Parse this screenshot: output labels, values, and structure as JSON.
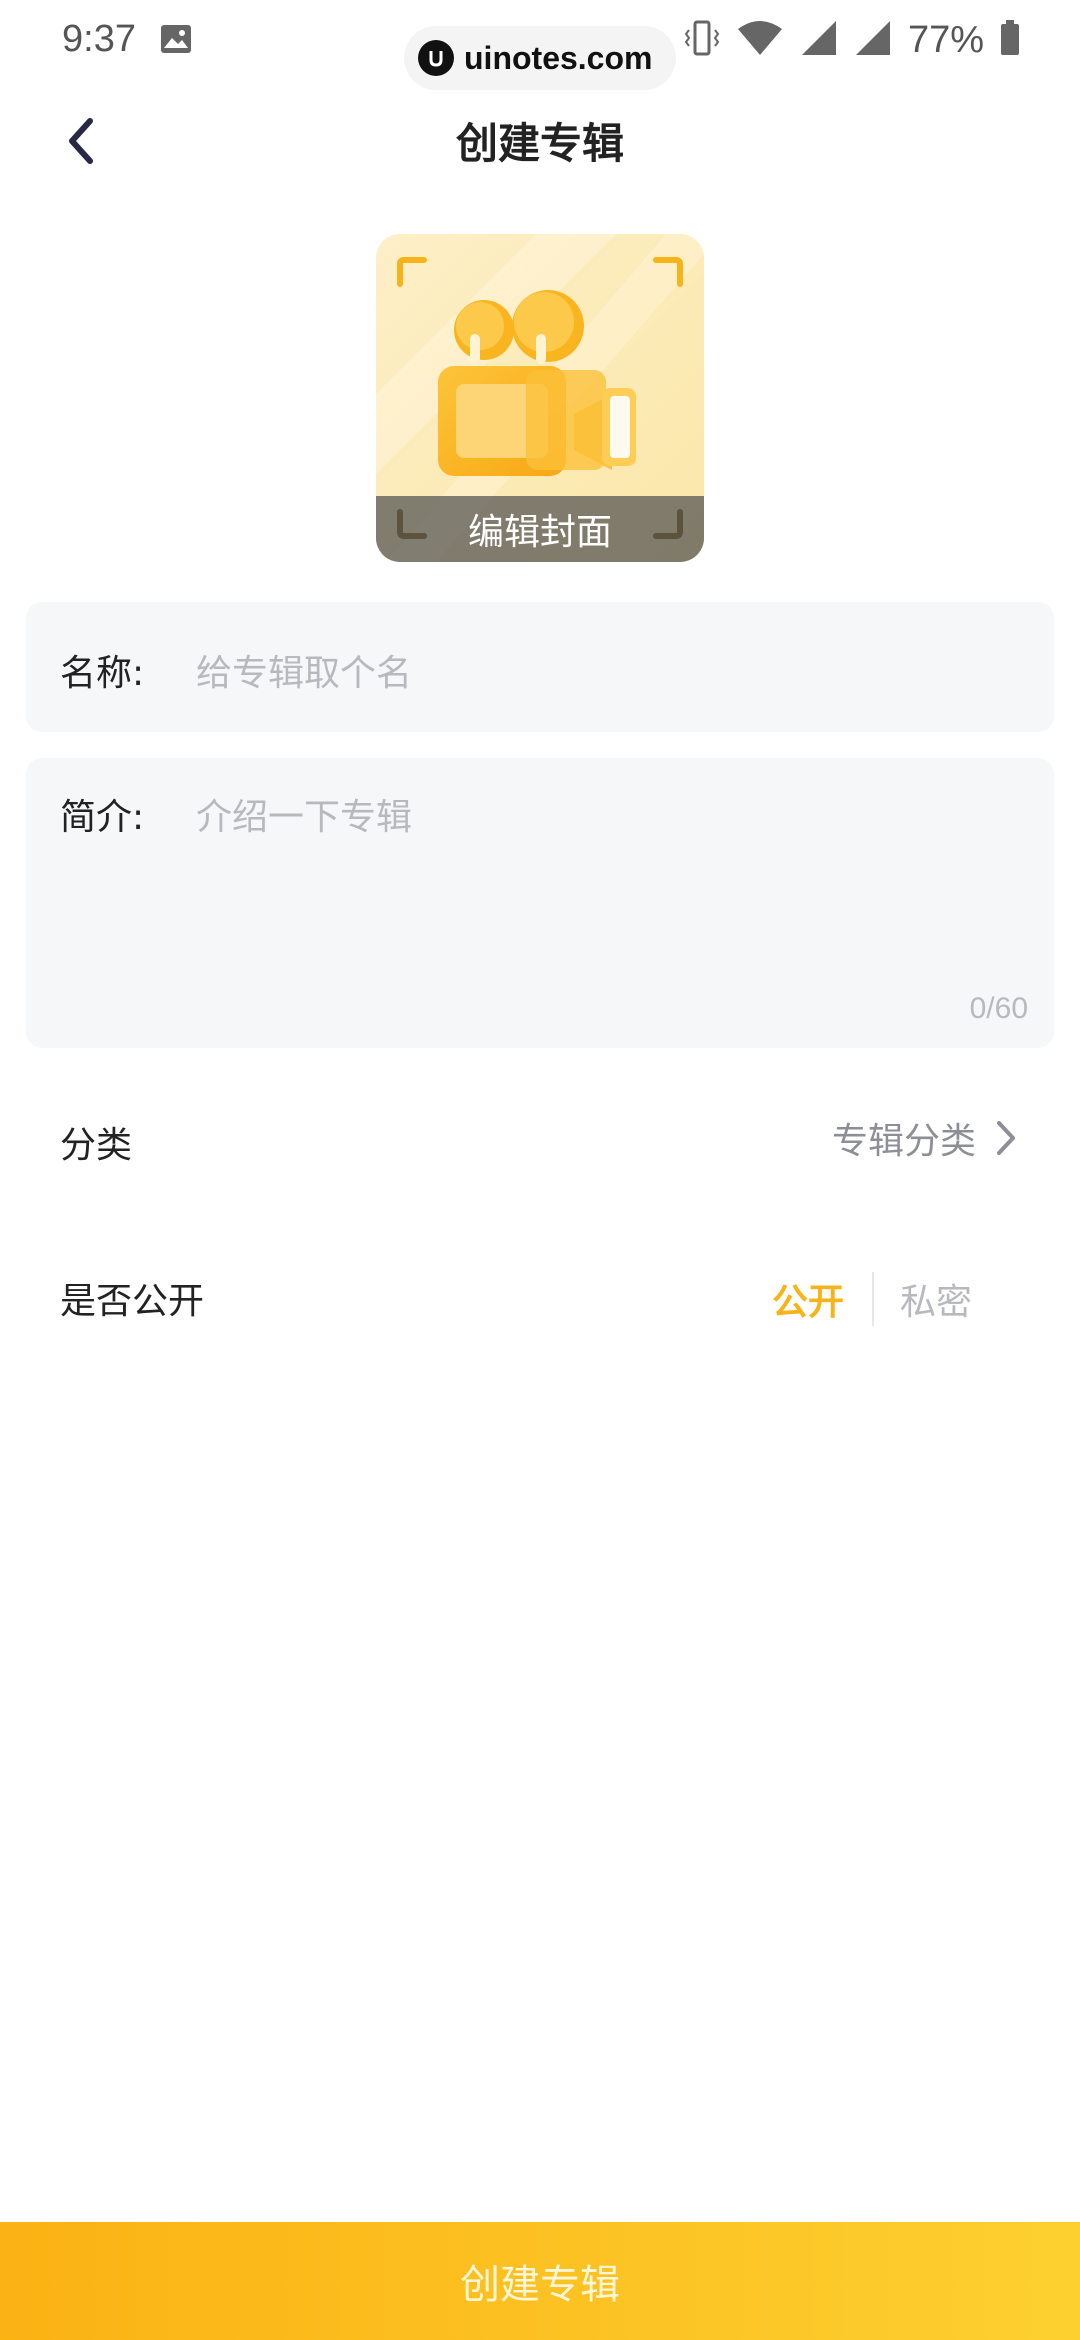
{
  "status_bar": {
    "time": "9:37",
    "watermark": "uinotes.com",
    "battery": "77%",
    "icons": [
      "image-icon",
      "vibrate-icon",
      "wifi-icon",
      "signal-icon",
      "signal-icon",
      "battery-icon"
    ]
  },
  "header": {
    "title": "创建专辑",
    "back_icon": "chevron-left-icon"
  },
  "cover": {
    "label": "编辑封面",
    "icon": "video-camera-icon"
  },
  "form": {
    "name": {
      "label": "名称:",
      "placeholder": "给专辑取个名"
    },
    "intro": {
      "label": "简介:",
      "placeholder": "介绍一下专辑",
      "counter": "0/60"
    },
    "category": {
      "label": "分类",
      "value": "专辑分类",
      "icon": "chevron-right-icon"
    },
    "visibility": {
      "label": "是否公开",
      "options": [
        "公开",
        "私密"
      ],
      "selected": "公开"
    }
  },
  "footer": {
    "button": "创建专辑"
  },
  "colors": {
    "accent": "#F7B41A",
    "field_bg": "#F6F7F9",
    "placeholder": "#B8B9BE"
  }
}
